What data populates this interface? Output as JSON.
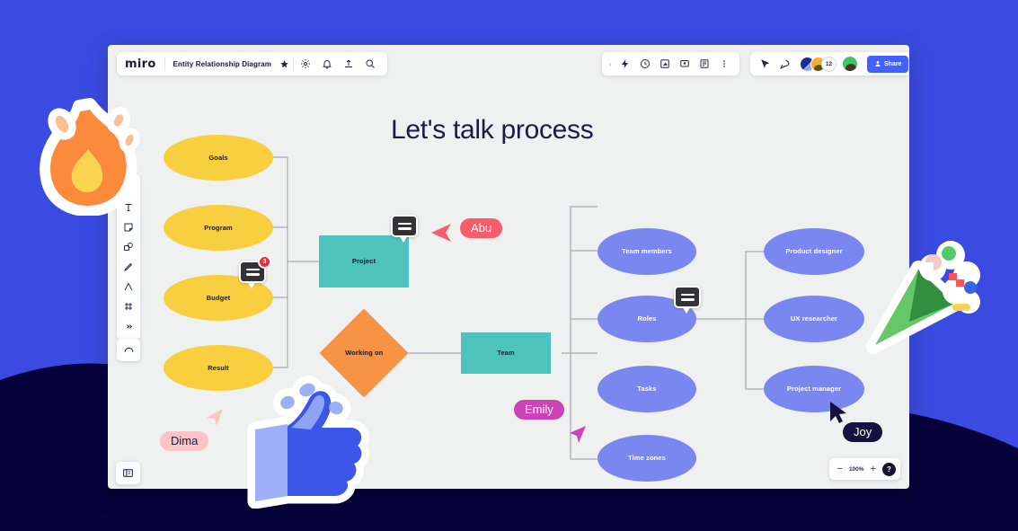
{
  "background": {
    "primary_color": "#3b4ae0",
    "wave_color": "#05033a"
  },
  "app": {
    "logo": "miro",
    "document_title": "Entity Relationship Diagram",
    "topbar_left_icons": [
      "star-icon",
      "gear-icon",
      "bell-icon",
      "upload-icon",
      "search-icon"
    ],
    "topbar_mid_icons": [
      "chevron-right-icon",
      "lightning-icon",
      "timer-icon",
      "frame-icon",
      "presentation-icon",
      "card-icon",
      "more-icon"
    ],
    "topbar_right_icons": [
      "cursor-share-icon",
      "rocket-icon"
    ],
    "avatar_count_badge": "12",
    "share_label": "Share"
  },
  "toolbar": {
    "tools": [
      {
        "name": "select-tool",
        "icon": "cursor-icon"
      },
      {
        "name": "text-tool",
        "icon": "text-icon"
      },
      {
        "name": "sticky-note-tool",
        "icon": "sticky-note-icon"
      },
      {
        "name": "shapes-tool",
        "icon": "shapes-icon"
      },
      {
        "name": "pen-tool",
        "icon": "pen-icon"
      },
      {
        "name": "connector-tool",
        "icon": "connector-icon"
      },
      {
        "name": "frame-tool",
        "icon": "frame-icon"
      },
      {
        "name": "more-tools",
        "icon": "more-icon"
      }
    ],
    "undo": {
      "name": "undo-tool",
      "icon": "undo-icon"
    },
    "panel_toggle": {
      "name": "panel-toggle",
      "icon": "panel-icon"
    }
  },
  "zoom_control": {
    "minus": "−",
    "level": "100%",
    "plus": "+",
    "help": "?"
  },
  "canvas": {
    "title_plain": "Let's talk",
    "title_highlight": "process",
    "highlight_color": "#fbb9bd"
  },
  "chart_data": {
    "type": "diagram",
    "title": "Let's talk process",
    "nodes": [
      {
        "id": "goals",
        "label": "Goals",
        "shape": "ellipse",
        "color": "#f8cf3e"
      },
      {
        "id": "program",
        "label": "Program",
        "shape": "ellipse",
        "color": "#f8cf3e"
      },
      {
        "id": "budget",
        "label": "Budget",
        "shape": "ellipse",
        "color": "#f8cf3e"
      },
      {
        "id": "result",
        "label": "Result",
        "shape": "ellipse",
        "color": "#f8cf3e"
      },
      {
        "id": "project",
        "label": "Project",
        "shape": "rect",
        "color": "#4ec3bd"
      },
      {
        "id": "working-on",
        "label": "Working on",
        "shape": "diamond",
        "color": "#f79344"
      },
      {
        "id": "team",
        "label": "Team",
        "shape": "rect",
        "color": "#4ec3bd"
      },
      {
        "id": "team-members",
        "label": "Team members",
        "shape": "ellipse",
        "color": "#7b87f0"
      },
      {
        "id": "roles",
        "label": "Roles",
        "shape": "ellipse",
        "color": "#7b87f0"
      },
      {
        "id": "tasks",
        "label": "Tasks",
        "shape": "ellipse",
        "color": "#7b87f0"
      },
      {
        "id": "time-zones",
        "label": "Time zones",
        "shape": "ellipse",
        "color": "#7b87f0"
      },
      {
        "id": "product-designer",
        "label": "Product designer",
        "shape": "ellipse",
        "color": "#7b87f0"
      },
      {
        "id": "ux-researcher",
        "label": "UX researcher",
        "shape": "ellipse",
        "color": "#7b87f0"
      },
      {
        "id": "project-manager",
        "label": "Project manager",
        "shape": "ellipse",
        "color": "#7b87f0"
      }
    ],
    "edges": [
      [
        "goals",
        "project"
      ],
      [
        "program",
        "project"
      ],
      [
        "budget",
        "project"
      ],
      [
        "result",
        "project"
      ],
      [
        "project",
        "working-on"
      ],
      [
        "working-on",
        "team"
      ],
      [
        "team",
        "team-members"
      ],
      [
        "team",
        "roles"
      ],
      [
        "team",
        "tasks"
      ],
      [
        "team",
        "time-zones"
      ],
      [
        "roles",
        "product-designer"
      ],
      [
        "roles",
        "ux-researcher"
      ],
      [
        "roles",
        "project-manager"
      ]
    ]
  },
  "comments": [
    {
      "name": "comment-budget",
      "badge": "3"
    },
    {
      "name": "comment-project",
      "badge": ""
    },
    {
      "name": "comment-roles",
      "badge": ""
    }
  ],
  "collaborators": [
    {
      "name": "Abu",
      "bg": "#fb5c6b",
      "fg": "#ffffff"
    },
    {
      "name": "Emily",
      "bg": "#cc45b8",
      "fg": "#ffffff"
    },
    {
      "name": "Dima",
      "bg": "#fbc4c6",
      "fg": "#1b1b4a"
    },
    {
      "name": "Joy",
      "bg": "#16123f",
      "fg": "#ffffff"
    }
  ],
  "stickers": [
    {
      "name": "fire-sticker",
      "emoji": "fire"
    },
    {
      "name": "party-popper-sticker",
      "emoji": "party-popper"
    },
    {
      "name": "thumbs-up-sticker",
      "emoji": "thumbs-up"
    }
  ]
}
